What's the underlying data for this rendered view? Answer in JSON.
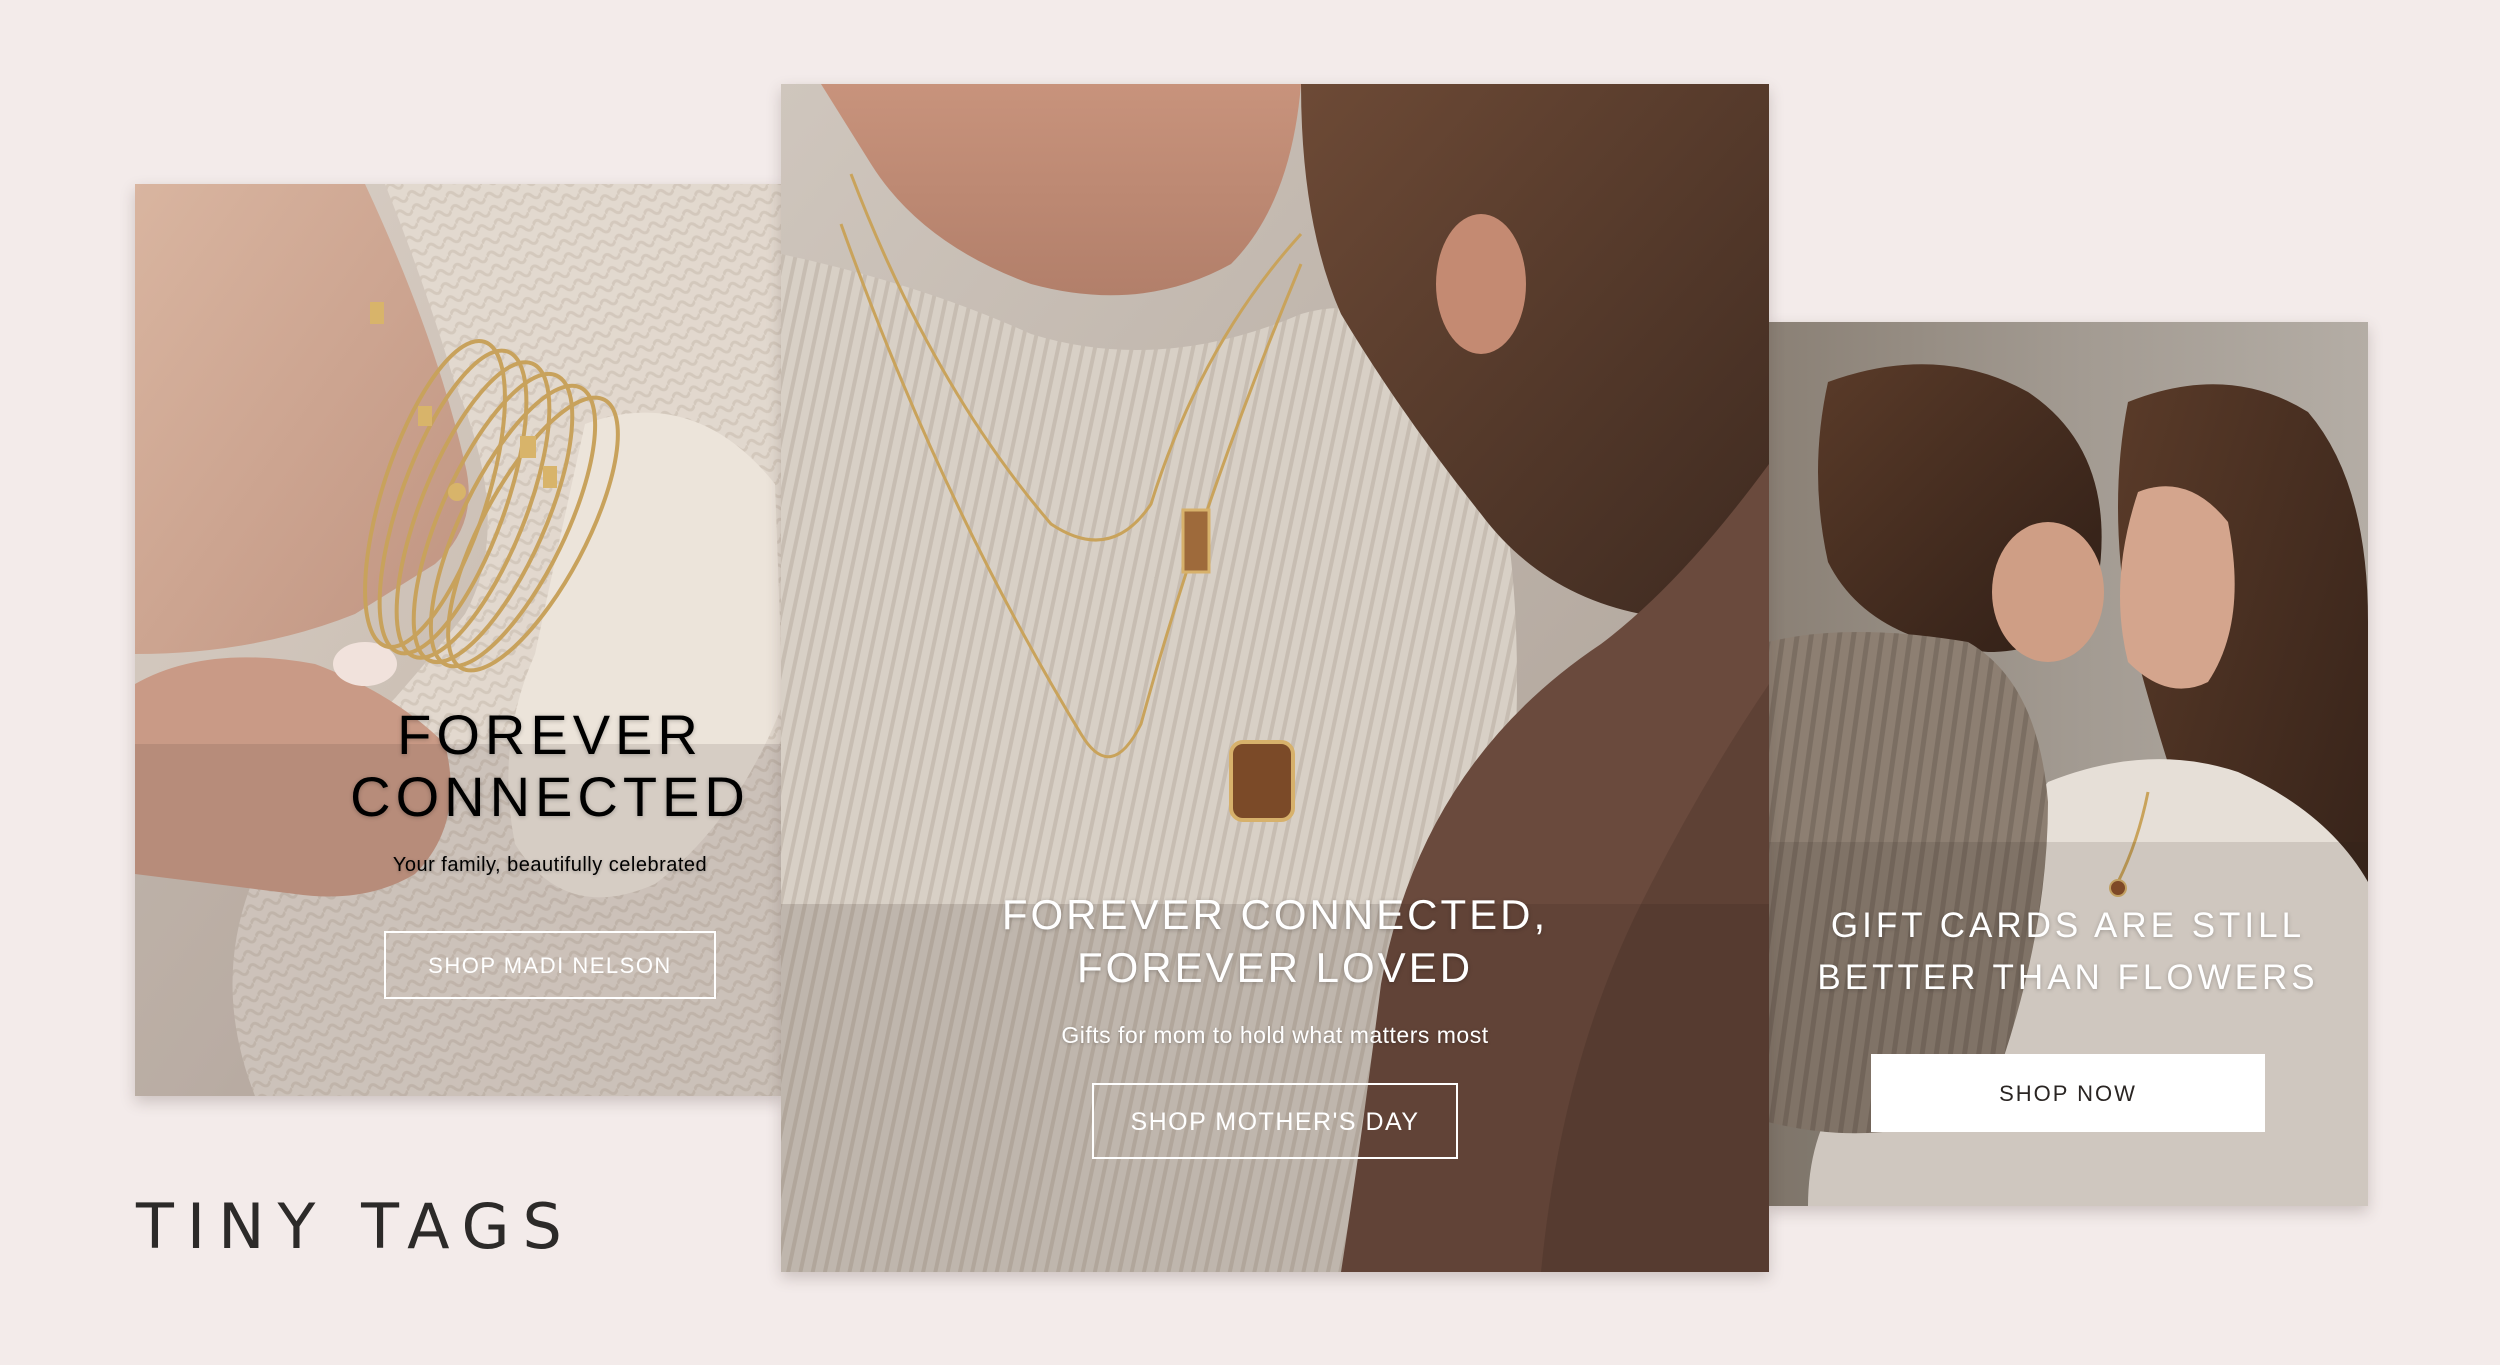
{
  "brand": {
    "logo_text": "TINY TAGS"
  },
  "colors": {
    "page_background": "#f3ebea",
    "button_outline": "#ffffff",
    "button_fill_right": "#ffffff",
    "logo_text": "#2c2a29"
  },
  "banners": {
    "left": {
      "headline_line1": "FOREVER",
      "headline_line2": "CONNECTED",
      "subtitle": "Your family, beautifully celebrated",
      "cta_label": "SHOP MADI NELSON",
      "image_subject": "hand wearing stacked gold initial bangles with cream knit sweater"
    },
    "center": {
      "headline_line1": "FOREVER CONNECTED,",
      "headline_line2": "FOREVER LOVED",
      "subtitle": "Gifts for mom to hold what matters most",
      "cta_label": "SHOP MOTHER'S DAY",
      "image_subject": "mother and child embracing, gold pendant necklaces"
    },
    "right": {
      "headline_line1": "GIFT CARDS ARE STILL",
      "headline_line2": "BETTER THAN FLOWERS",
      "cta_label": "SHOP NOW",
      "image_subject": "mother and daughter touching foreheads"
    }
  }
}
